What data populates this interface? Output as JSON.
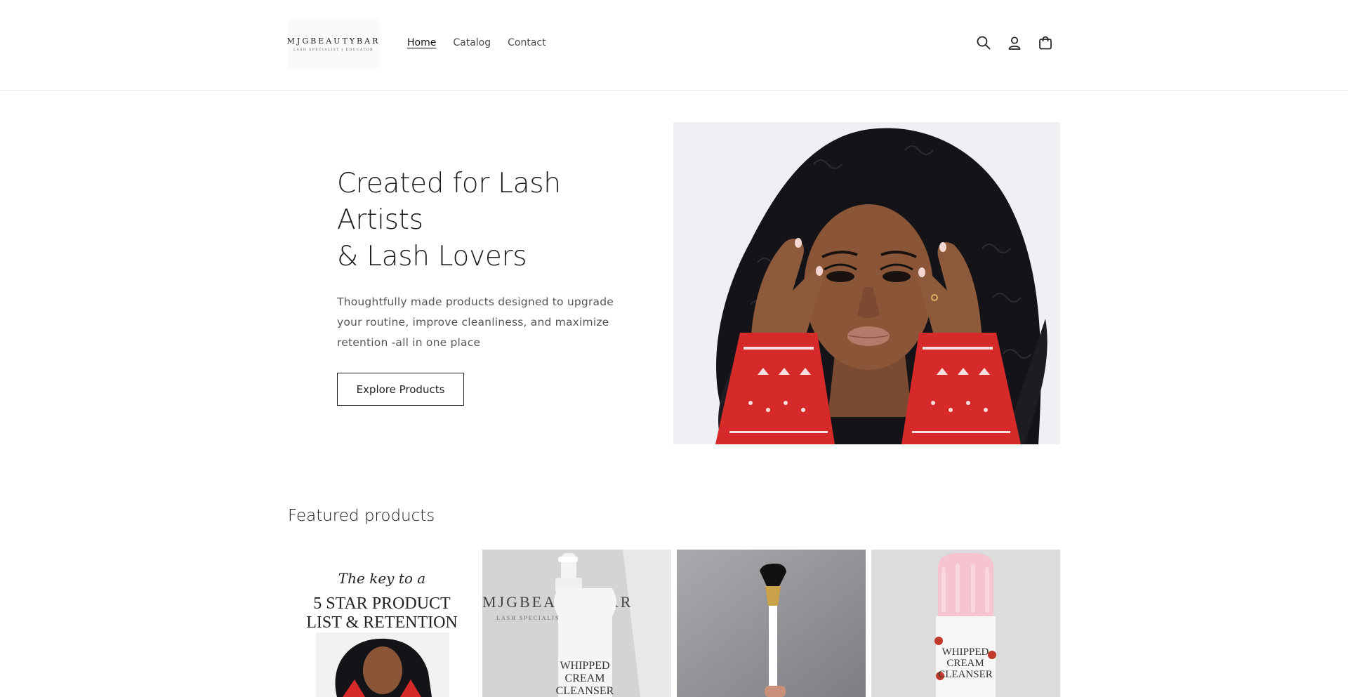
{
  "header": {
    "logo_text": "MJGBEAUTYBAR",
    "logo_subtext": "LASH SPECIALIST | EDUCATOR",
    "nav": [
      {
        "label": "Home",
        "active": true
      },
      {
        "label": "Catalog",
        "active": false
      },
      {
        "label": "Contact",
        "active": false
      }
    ],
    "icons": [
      "search-icon",
      "account-icon",
      "cart-icon"
    ]
  },
  "hero": {
    "title_line1": "Created for Lash Artists",
    "title_line2": "& Lash Lovers",
    "description": "Thoughtfully made products designed to upgrade your routine, improve cleanliness, and maximize retention -all in one place",
    "button_label": "Explore Products",
    "image_alt": "Model with curly hair wearing a red holiday sweater"
  },
  "featured": {
    "title": "Featured products",
    "products": [
      {
        "image_text_script": "The key to a",
        "image_text_1": "5 STAR PRODUCT",
        "image_text_2": "LIST & RETENTION"
      },
      {
        "image_text_1": "MJGBEAUTYBAR",
        "image_text_2": "LASH SPECIALIST | EDUCATOR",
        "label_1": "WHIPPED",
        "label_2": "CREAM",
        "label_3": "CLEANSER"
      },
      {},
      {
        "label_1": "WHIPPED",
        "label_2": "CREAM",
        "label_3": "CLEANSER"
      }
    ]
  },
  "colors": {
    "accent_red": "#d62a2a",
    "text": "#121212",
    "border": "#e6e6e6"
  }
}
